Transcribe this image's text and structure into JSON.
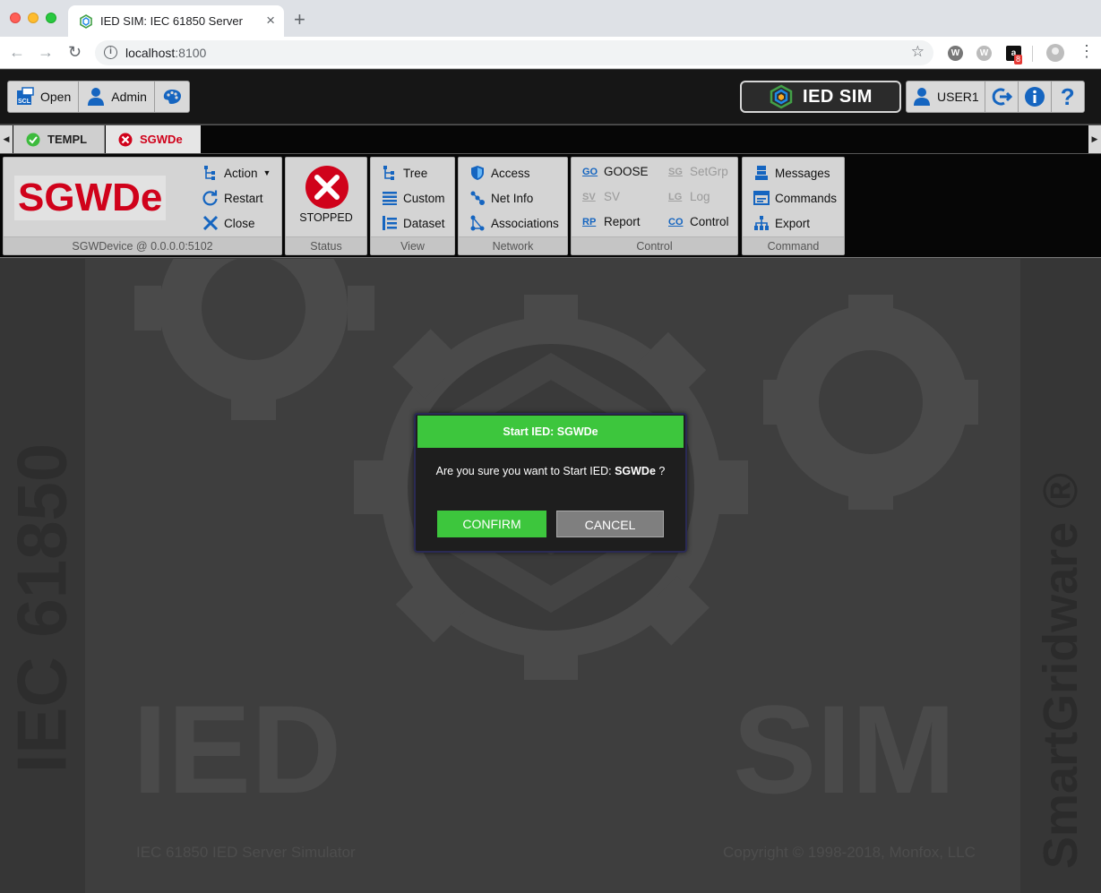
{
  "browser": {
    "tab_title": "IED SIM: IEC 61850 Server",
    "url_host": "localhost",
    "url_port": ":8100",
    "ext_badge": "8",
    "ext1_letter": "W",
    "ext2_letter": "W",
    "ext3_letter": "a"
  },
  "toolbar": {
    "open_label": "Open",
    "admin_label": "Admin",
    "logo_text": "IED SIM",
    "user_label": "USER1"
  },
  "ied_tabs": [
    {
      "label": "TEMPL",
      "status": "ok"
    },
    {
      "label": "SGWDe",
      "status": "stopped"
    }
  ],
  "ribbon": {
    "device": {
      "name": "SGWDe",
      "address": "SGWDevice @ 0.0.0.0:5102"
    },
    "device_actions": {
      "action": "Action",
      "restart": "Restart",
      "close": "Close"
    },
    "status": {
      "state": "STOPPED",
      "label": "Status"
    },
    "view": {
      "label": "View",
      "items": [
        "Tree",
        "Custom",
        "Dataset"
      ]
    },
    "network": {
      "label": "Network",
      "items": [
        "Access",
        "Net Info",
        "Associations"
      ]
    },
    "control": {
      "label": "Control",
      "goose": {
        "tag": "GO",
        "label": "GOOSE"
      },
      "sv": {
        "tag": "SV",
        "label": "SV"
      },
      "report": {
        "tag": "RP",
        "label": "Report"
      },
      "setgrp": {
        "tag": "SG",
        "label": "SetGrp"
      },
      "log": {
        "tag": "LG",
        "label": "Log"
      },
      "control": {
        "tag": "CO",
        "label": "Control"
      }
    },
    "command": {
      "label": "Command",
      "items": [
        "Messages",
        "Commands",
        "Export"
      ]
    }
  },
  "background": {
    "left_vertical": "IEC 61850",
    "right_vertical": "SmartGridware ®",
    "big_left": "IED",
    "big_right": "SIM",
    "footer_left": "IEC 61850 IED Server Simulator",
    "footer_right": "Copyright © 1998-2018, Monfox, LLC"
  },
  "dialog": {
    "title": "Start IED: SGWDe",
    "message_prefix": "Are you sure you want to Start IED: ",
    "message_name": "SGWDe",
    "message_suffix": " ?",
    "confirm_label": "CONFIRM",
    "cancel_label": "CANCEL"
  },
  "colors": {
    "accent_green": "#3dc63d",
    "device_red": "#d0021b",
    "icon_blue": "#1565c0"
  }
}
